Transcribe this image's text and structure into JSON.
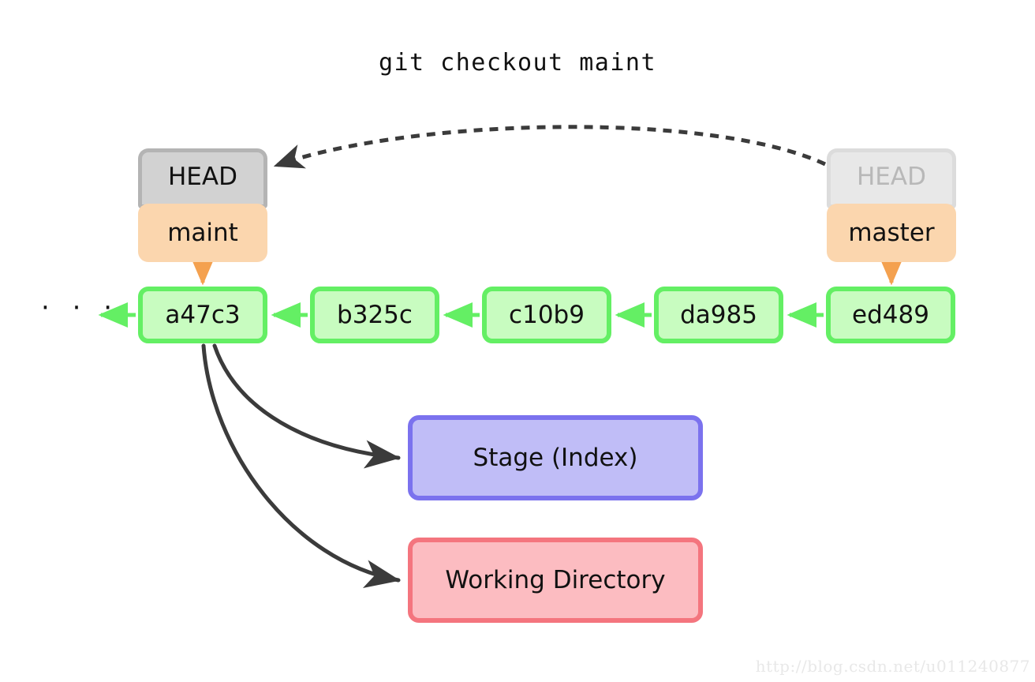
{
  "title": "git checkout maint",
  "colors": {
    "commit_border": "#64ef64",
    "commit_fill": "#c8fcc0",
    "ref_border": "#f4a14f",
    "ref_fill": "#fbd6ae",
    "head_border": "#b4b4b4",
    "head_fill": "#d2d2d2",
    "head_faded_border": "#dcdcdc",
    "head_faded_fill": "#e8e8e8",
    "head_faded_text": "#b8b8b8",
    "stage_border": "#7b72ee",
    "stage_fill": "#c0bdf7",
    "working_border": "#f4757e",
    "working_fill": "#fcbcc1",
    "arrow_dark": "#3b3b3b",
    "text": "#111111",
    "watermark": "#e8e8e8",
    "background": "#ffffff"
  },
  "heads": {
    "active": {
      "label": "HEAD",
      "state": "active"
    },
    "previous": {
      "label": "HEAD",
      "state": "faded"
    }
  },
  "refs": [
    {
      "label": "maint"
    },
    {
      "label": "master"
    }
  ],
  "commits": [
    {
      "label": "a47c3"
    },
    {
      "label": "b325c"
    },
    {
      "label": "c10b9"
    },
    {
      "label": "da985"
    },
    {
      "label": "ed489"
    }
  ],
  "history_ellipsis": "· · ·",
  "areas": [
    {
      "label": "Stage (Index)"
    },
    {
      "label": "Working Directory"
    }
  ],
  "arrows": {
    "head_move": {
      "style": "dashed",
      "from": "previous-head",
      "to": "active-head"
    },
    "ref_to_commit": [
      {
        "from": "maint",
        "to": "a47c3",
        "style": "solid-orange"
      },
      {
        "from": "master",
        "to": "ed489",
        "style": "solid-orange"
      }
    ],
    "commit_chain": [
      {
        "from": "a47c3",
        "to": "history",
        "style": "solid-green"
      },
      {
        "from": "b325c",
        "to": "a47c3",
        "style": "solid-green"
      },
      {
        "from": "c10b9",
        "to": "b325c",
        "style": "solid-green"
      },
      {
        "from": "da985",
        "to": "c10b9",
        "style": "solid-green"
      },
      {
        "from": "ed489",
        "to": "da985",
        "style": "solid-green"
      }
    ],
    "checkout_targets": [
      {
        "from": "a47c3",
        "to": "Stage (Index)",
        "style": "solid-dark-curve"
      },
      {
        "from": "a47c3",
        "to": "Working Directory",
        "style": "solid-dark-curve"
      }
    ]
  },
  "watermark": "http://blog.csdn.net/u011240877"
}
